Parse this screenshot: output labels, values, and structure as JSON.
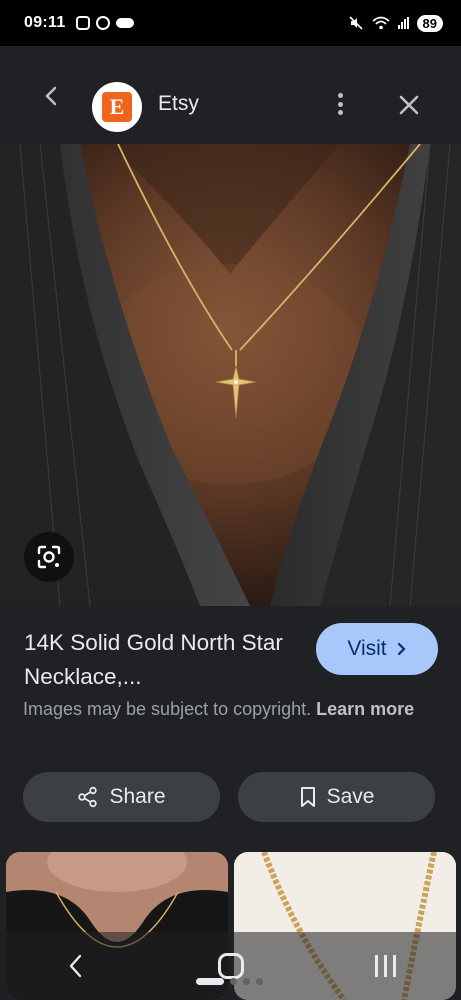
{
  "status_bar": {
    "time": "09:11",
    "battery": "89",
    "left_icons": [
      "screenshot-icon",
      "messenger-icon",
      "notification-pill-icon"
    ],
    "right_icons": [
      "mute-icon",
      "wifi-icon",
      "signal-icon"
    ]
  },
  "header": {
    "site_name": "Etsy",
    "logo_letter": "E",
    "brand_color": "#f1641e",
    "icons": [
      "back-arrow-icon",
      "more-vert-icon",
      "close-icon"
    ]
  },
  "result": {
    "title": "14K Solid Gold North Star Necklace,...",
    "visit_label": "Visit",
    "copyright_text": "Images may be subject to copyright.",
    "learn_more": "Learn more",
    "share_label": "Share",
    "save_label": "Save"
  },
  "colors": {
    "background": "#202124",
    "visit_button": "#a8c7fa",
    "action_button": "#3c4043"
  }
}
